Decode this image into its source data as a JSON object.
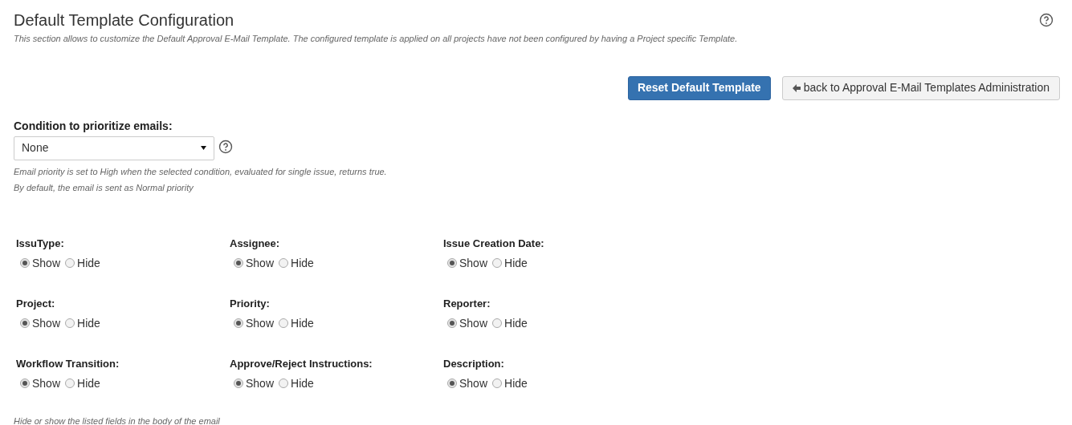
{
  "header": {
    "title": "Default Template Configuration",
    "description": "This section allows to customize the Default Approval E-Mail Template. The configured template is applied on all projects have not been configured by having a Project specific Template."
  },
  "actions": [
    {
      "kind": "primary",
      "label": "Reset Default Template"
    },
    {
      "kind": "back",
      "label": "back to Approval E-Mail Templates Administration"
    }
  ],
  "priority_condition": {
    "label": "Condition to prioritize emails:",
    "value": "None",
    "notes": [
      "Email priority is set to High when the selected condition, evaluated for single issue, returns true.",
      "By default, the email is sent as Normal priority"
    ]
  },
  "fields": [
    {
      "label": "IssuType:",
      "options": [
        {
          "label": "Show",
          "selected": true
        },
        {
          "label": "Hide",
          "selected": false
        }
      ]
    },
    {
      "label": "Assignee:",
      "options": [
        {
          "label": "Show",
          "selected": true
        },
        {
          "label": "Hide",
          "selected": false
        }
      ]
    },
    {
      "label": "Issue Creation Date:",
      "options": [
        {
          "label": "Show",
          "selected": true
        },
        {
          "label": "Hide",
          "selected": false
        }
      ]
    },
    {
      "label": "Project:",
      "options": [
        {
          "label": "Show",
          "selected": true
        },
        {
          "label": "Hide",
          "selected": false
        }
      ]
    },
    {
      "label": "Priority:",
      "options": [
        {
          "label": "Show",
          "selected": true
        },
        {
          "label": "Hide",
          "selected": false
        }
      ]
    },
    {
      "label": "Reporter:",
      "options": [
        {
          "label": "Show",
          "selected": true
        },
        {
          "label": "Hide",
          "selected": false
        }
      ]
    },
    {
      "label": "Workflow Transition:",
      "options": [
        {
          "label": "Show",
          "selected": true
        },
        {
          "label": "Hide",
          "selected": false
        }
      ]
    },
    {
      "label": "Approve/Reject Instructions:",
      "options": [
        {
          "label": "Show",
          "selected": true
        },
        {
          "label": "Hide",
          "selected": false
        }
      ]
    },
    {
      "label": "Description:",
      "options": [
        {
          "label": "Show",
          "selected": true
        },
        {
          "label": "Hide",
          "selected": false
        }
      ]
    }
  ],
  "fields_note": "Hide or show the listed fields in the body of the email"
}
